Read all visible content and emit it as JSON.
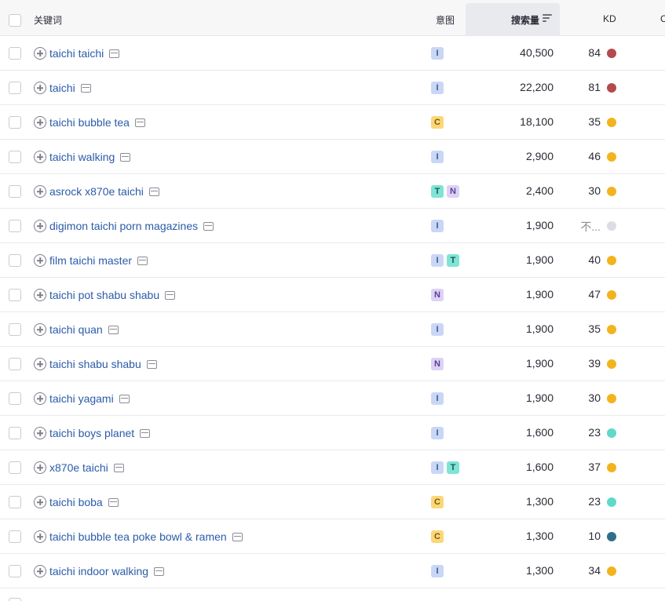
{
  "header": {
    "keyword": "关键词",
    "intent": "意图",
    "volume": "搜索量",
    "kd": "KD",
    "extra": "C"
  },
  "rows": [
    {
      "keyword": "taichi taichi",
      "intents": [
        "I"
      ],
      "volume": "40,500",
      "kd": "84",
      "kd_color": "#b44a4d"
    },
    {
      "keyword": "taichi",
      "intents": [
        "I"
      ],
      "volume": "22,200",
      "kd": "81",
      "kd_color": "#b44a4d"
    },
    {
      "keyword": "taichi bubble tea",
      "intents": [
        "C"
      ],
      "volume": "18,100",
      "kd": "35",
      "kd_color": "#f2b41d"
    },
    {
      "keyword": "taichi walking",
      "intents": [
        "I"
      ],
      "volume": "2,900",
      "kd": "46",
      "kd_color": "#f2b41d"
    },
    {
      "keyword": "asrock x870e taichi",
      "intents": [
        "T",
        "N"
      ],
      "volume": "2,400",
      "kd": "30",
      "kd_color": "#f2b41d"
    },
    {
      "keyword": "digimon taichi porn magazines",
      "intents": [
        "I"
      ],
      "volume": "1,900",
      "kd": "不...",
      "kd_color": "#dcdde2",
      "kd_na": true
    },
    {
      "keyword": "film taichi master",
      "intents": [
        "I",
        "T"
      ],
      "volume": "1,900",
      "kd": "40",
      "kd_color": "#f2b41d"
    },
    {
      "keyword": "taichi pot shabu shabu",
      "intents": [
        "N"
      ],
      "volume": "1,900",
      "kd": "47",
      "kd_color": "#f2b41d"
    },
    {
      "keyword": "taichi quan",
      "intents": [
        "I"
      ],
      "volume": "1,900",
      "kd": "35",
      "kd_color": "#f2b41d"
    },
    {
      "keyword": "taichi shabu shabu",
      "intents": [
        "N"
      ],
      "volume": "1,900",
      "kd": "39",
      "kd_color": "#f2b41d"
    },
    {
      "keyword": "taichi yagami",
      "intents": [
        "I"
      ],
      "volume": "1,900",
      "kd": "30",
      "kd_color": "#f2b41d"
    },
    {
      "keyword": "taichi boys planet",
      "intents": [
        "I"
      ],
      "volume": "1,600",
      "kd": "23",
      "kd_color": "#5fd9c8"
    },
    {
      "keyword": "x870e taichi",
      "intents": [
        "I",
        "T"
      ],
      "volume": "1,600",
      "kd": "37",
      "kd_color": "#f2b41d"
    },
    {
      "keyword": "taichi boba",
      "intents": [
        "C"
      ],
      "volume": "1,300",
      "kd": "23",
      "kd_color": "#5fd9c8"
    },
    {
      "keyword": "taichi bubble tea poke bowl & ramen",
      "intents": [
        "C"
      ],
      "volume": "1,300",
      "kd": "10",
      "kd_color": "#2f6f8a"
    },
    {
      "keyword": "taichi indoor walking",
      "intents": [
        "I"
      ],
      "volume": "1,300",
      "kd": "34",
      "kd_color": "#f2b41d"
    }
  ]
}
